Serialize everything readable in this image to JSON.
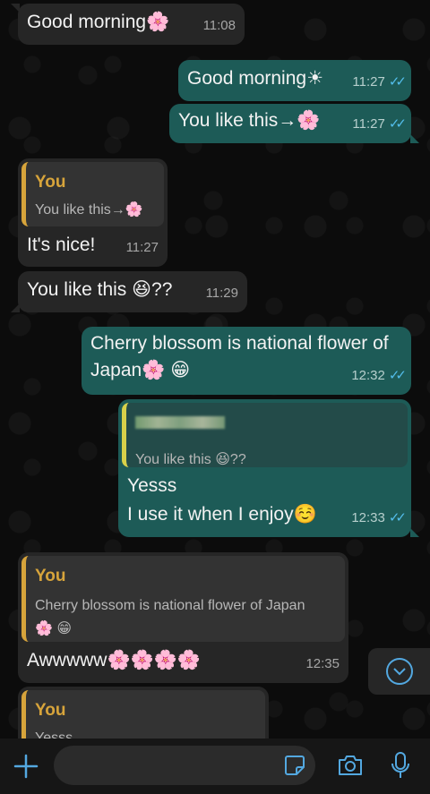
{
  "messages": {
    "m1": {
      "text": "Good morning🌸",
      "time": "11:08"
    },
    "m2": {
      "text": "Good morning☀",
      "time": "11:27",
      "ticks": "✓✓"
    },
    "m3": {
      "text": "You like this→🌸",
      "time": "11:27",
      "ticks": "✓✓"
    },
    "m4": {
      "quote_author": "You",
      "quote_text": "You like this→🌸",
      "text": "It's nice!",
      "time": "11:27"
    },
    "m5": {
      "text": "You like this 😆??",
      "time": "11:29"
    },
    "m6": {
      "text": "Cherry blossom is national flower of Japan🌸 😁",
      "time": "12:32",
      "ticks": "✓✓"
    },
    "m7": {
      "quote_text": "You like this 😆??",
      "line1": "Yesss",
      "line2": "I use it when I enjoy☺️",
      "time": "12:33",
      "ticks": "✓✓"
    },
    "m8": {
      "quote_author": "You",
      "quote_text": "Cherry blossom is national flower of Japan",
      "quote_emojis": "🌸 😁",
      "text": "Awwwww🌸🌸🌸🌸",
      "time": "12:35"
    },
    "m9": {
      "quote_author": "You",
      "quote_text": "Yesss"
    }
  },
  "colors": {
    "incoming_bubble": "#262626",
    "outgoing_bubble": "#1d5b57",
    "read_ticks": "#53bdeb",
    "quote_accent": "#d7a43b",
    "icon_blue": "#53a8e0"
  },
  "input_bar": {
    "icons": [
      "plus-icon",
      "sticker-icon",
      "camera-icon",
      "microphone-icon"
    ]
  }
}
